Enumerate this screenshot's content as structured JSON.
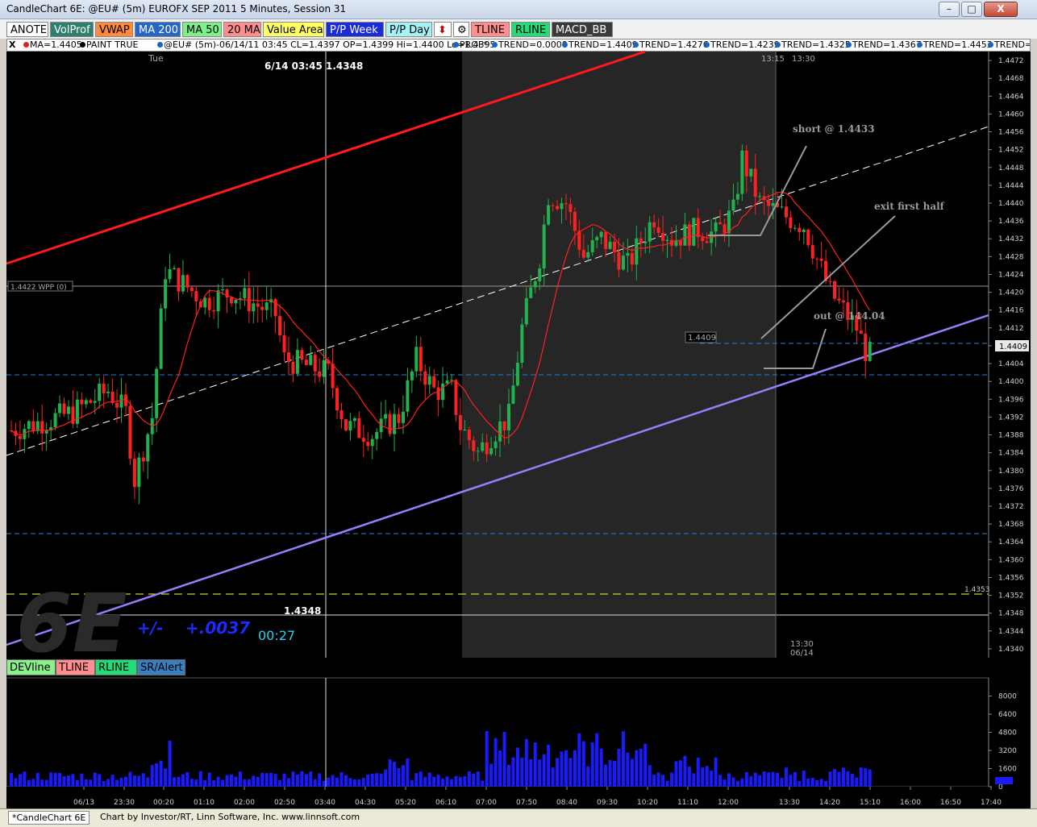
{
  "window": {
    "title": "CandleChart 6E: @EU# (5m) EUROFX SEP 2011 5 Minutes, Session 31",
    "controls": [
      "–",
      "□",
      "X"
    ]
  },
  "toolbar": {
    "buttons": [
      {
        "label": "ANOTE",
        "bg": "#ffffff",
        "fg": "#000000"
      },
      {
        "label": "VolProf",
        "bg": "#2f7f6f",
        "fg": "#ffffff"
      },
      {
        "label": "VWAP",
        "bg": "#ff8a3c",
        "fg": "#000000"
      },
      {
        "label": "MA 200",
        "bg": "#2566c8",
        "fg": "#ffffff"
      },
      {
        "label": "MA 50",
        "bg": "#7cf08a",
        "fg": "#000000"
      },
      {
        "label": "20 MA",
        "bg": "#ff8f8f",
        "fg": "#000000"
      },
      {
        "label": "Value Area",
        "bg": "#ffff66",
        "fg": "#000000"
      },
      {
        "label": "P/P Week",
        "bg": "#1a2bd8",
        "fg": "#ffffff"
      },
      {
        "label": "P/P Day",
        "bg": "#a5f3f6",
        "fg": "#000000"
      },
      {
        "label": "⬍",
        "bg": "#ffffff",
        "fg": "#c00000"
      },
      {
        "label": "⚙",
        "bg": "#ffffff",
        "fg": "#000000"
      },
      {
        "label": "TLINE",
        "bg": "#ff8f8f",
        "fg": "#000000"
      },
      {
        "label": "RLINE",
        "bg": "#22dd77",
        "fg": "#000000"
      },
      {
        "label": "MACD_BB",
        "bg": "#3a3a3a",
        "fg": "#ffffff"
      }
    ]
  },
  "indicator_bar": {
    "close_glyph": "X",
    "items": [
      {
        "text": "MA=1.4405",
        "color": "#e02020"
      },
      {
        "text": "PAINT TRUE",
        "color": "#000000"
      },
      {
        "text": "@EU# (5m)-06/14/11 03:45 CL=1.4397 OP=1.4399 Hi=1.4400 Lo=1.4395",
        "color": "#2060c0"
      },
      {
        "text": "PROF*",
        "color": "#2060c0"
      },
      {
        "text": "TREND=0.0000",
        "color": "#2060c0"
      },
      {
        "text": "TREND=1.4409",
        "color": "#2060c0"
      },
      {
        "text": "TREND=1.4276",
        "color": "#2060c0"
      },
      {
        "text": "TREND=1.4239",
        "color": "#2060c0"
      },
      {
        "text": "TREND=1.4325",
        "color": "#2060c0"
      },
      {
        "text": "TREND=1.4367",
        "color": "#2060c0"
      },
      {
        "text": "TREND=1.4453",
        "color": "#2060c0"
      },
      {
        "text": "TREND=1.",
        "color": "#2060c0"
      }
    ]
  },
  "chart": {
    "day_label": "Tue",
    "cursor_readout": "6/14 03:45  1.4348",
    "session_start_time": "13:15",
    "session_end_time_top": "13:30",
    "session_end_time_bottom": "13:30",
    "session_end_date": "06/14",
    "wpp_label": "1.4422 WPP (0)",
    "trend_label": "1.4409",
    "last_price": "1.4409",
    "value_area_label": "1.4353",
    "crosshair_price": "1.4348",
    "symbol_watermark": "6E",
    "range_label": "+/-",
    "range_value": "+.0037",
    "countdown": "00:27",
    "annotations": {
      "short": "short  @ 1.4433",
      "exit_first_half": "exit first half",
      "out": "out @ 144.04"
    },
    "price_ticks": [
      "1.4472",
      "1.4468",
      "1.4464",
      "1.4460",
      "1.4456",
      "1.4452",
      "1.4448",
      "1.4444",
      "1.4440",
      "1.4436",
      "1.4432",
      "1.4428",
      "1.4424",
      "1.4420",
      "1.4416",
      "1.4412",
      "1.4408",
      "1.4404",
      "1.4400",
      "1.4396",
      "1.4392",
      "1.4388",
      "1.4384",
      "1.4380",
      "1.4376",
      "1.4372",
      "1.4368",
      "1.4364",
      "1.4360",
      "1.4356",
      "1.4352",
      "1.4348",
      "1.4344",
      "1.4340"
    ]
  },
  "subbar": {
    "buttons": [
      {
        "label": "DEVline",
        "bg": "#8cf08c",
        "fg": "#000000"
      },
      {
        "label": "TLINE",
        "bg": "#ff8f8f",
        "fg": "#000000"
      },
      {
        "label": "RLINE",
        "bg": "#22dd77",
        "fg": "#000000"
      },
      {
        "label": "SR/Alert",
        "bg": "#3a7fc0",
        "fg": "#000000"
      }
    ]
  },
  "volume": {
    "ticks": [
      "8000",
      "6400",
      "4800",
      "3200",
      "1600",
      "0"
    ]
  },
  "time_axis": [
    "06/13",
    "23:30",
    "00:20",
    "01:10",
    "02:00",
    "02:50",
    "03:40",
    "04:30",
    "05:20",
    "06:10",
    "07:00",
    "07:50",
    "08:40",
    "09:30",
    "10:20",
    "11:10",
    "12:00",
    "13:30",
    "14:20",
    "15:10",
    "16:00",
    "16:50",
    "17:40"
  ],
  "footer": {
    "tab": "*CandleChart 6E",
    "credit": "Chart by Investor/RT, Linn Software, Inc. www.linnsoft.com"
  },
  "colors": {
    "up_candle": "#22b14c",
    "down_candle": "#ff2020",
    "ma": "#ff2020",
    "resistance": "#ff1a1a",
    "support": "#9b7cff",
    "midline": "#ffffff",
    "pivot_dashes": "#1f7fd6",
    "value_area_line": "#ffff33",
    "volume": "#1a1aff",
    "session_shade": "#262626"
  }
}
